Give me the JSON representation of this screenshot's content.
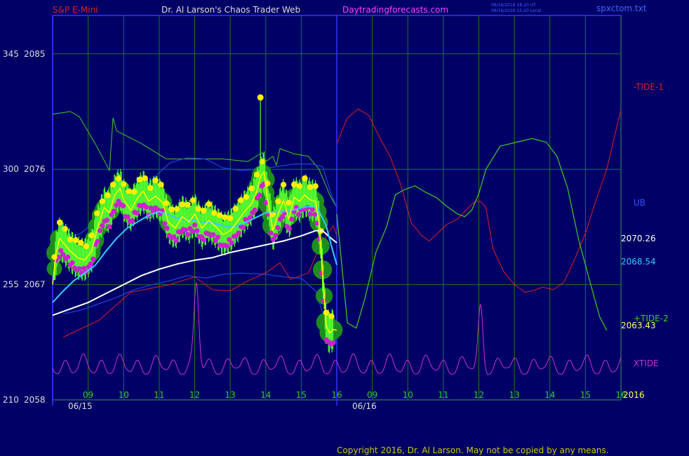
{
  "header": {
    "left": "S&P E-Mini",
    "center": "Dr. Al Larson's Chaos Trader Web",
    "site": "Daytradingforecasts.com",
    "stamp1": "06/16/2016 18:20 UT",
    "stamp2": "06/16/2016 15:20 Local",
    "file": "spxctom.txt"
  },
  "footer": {
    "copyright": "Copyright 2016, Dr. Al Larson. May not be copied by any means."
  },
  "colors": {
    "background": "#000066",
    "frame": "#3333ff",
    "grid": "#1a7a1a",
    "price": "#ffff00",
    "ma_fast": "#33ccff",
    "ma_slow": "#ffffff",
    "band": "#2244dd",
    "tide1": "#dd2222",
    "tide2": "#44cc22",
    "xtide": "#cc33cc",
    "text": "#dddddd",
    "header_red": "#dd2222",
    "header_site": "#ff44ff"
  },
  "chart_data": {
    "type": "line",
    "title": "S&P E-Mini",
    "ylim": [
      2058,
      2088
    ],
    "yticks_left": [
      {
        "a": "345",
        "b": "2085",
        "v": 2085
      },
      {
        "a": "300",
        "b": "2076",
        "v": 2076
      },
      {
        "a": "255",
        "b": "2067",
        "v": 2067
      },
      {
        "a": "210",
        "b": "2058",
        "v": 2058
      }
    ],
    "xticks": [
      {
        "label": "09",
        "x": 9.0
      },
      {
        "label": "10",
        "x": 10.0
      },
      {
        "label": "11",
        "x": 11.0
      },
      {
        "label": "12",
        "x": 12.0
      },
      {
        "label": "13",
        "x": 13.0
      },
      {
        "label": "14",
        "x": 14.0
      },
      {
        "label": "15",
        "x": 15.0
      },
      {
        "label": "16",
        "x": 16.0
      },
      {
        "label": "09",
        "x": 17.0
      },
      {
        "label": "10",
        "x": 18.0
      },
      {
        "label": "11",
        "x": 19.0
      },
      {
        "label": "12",
        "x": 20.0
      },
      {
        "label": "13",
        "x": 21.0
      },
      {
        "label": "14",
        "x": 22.0
      },
      {
        "label": "15",
        "x": 23.0
      },
      {
        "label": "16",
        "x": 24.0
      }
    ],
    "xlim": [
      8.0,
      24.0
    ],
    "days": [
      {
        "label": "06/15",
        "x": 8.0
      },
      {
        "label": "06/16",
        "x": 16.0
      }
    ],
    "right_labels": {
      "tide1": "-TIDE-1",
      "ub": "UB",
      "slow": "2070.26",
      "fast": "2068.54",
      "tide2": "+TIDE-2",
      "last": "2063.43",
      "xtide": "XTIDE",
      "year": "2016"
    },
    "series": {
      "price": [
        [
          8.0,
          2067.0
        ],
        [
          8.1,
          2069.5
        ],
        [
          8.2,
          2070.6
        ],
        [
          8.35,
          2070.1
        ],
        [
          8.5,
          2069.6
        ],
        [
          8.7,
          2069.1
        ],
        [
          8.9,
          2068.9
        ],
        [
          9.1,
          2069.6
        ],
        [
          9.25,
          2071.3
        ],
        [
          9.45,
          2073.0
        ],
        [
          9.6,
          2072.6
        ],
        [
          9.75,
          2074.0
        ],
        [
          9.9,
          2074.5
        ],
        [
          10.0,
          2073.6
        ],
        [
          10.2,
          2072.8
        ],
        [
          10.4,
          2073.8
        ],
        [
          10.55,
          2074.3
        ],
        [
          10.7,
          2073.5
        ],
        [
          10.9,
          2073.9
        ],
        [
          11.1,
          2073.4
        ],
        [
          11.25,
          2071.9
        ],
        [
          11.45,
          2071.4
        ],
        [
          11.65,
          2072.3
        ],
        [
          11.85,
          2071.9
        ],
        [
          12.0,
          2072.5
        ],
        [
          12.2,
          2071.4
        ],
        [
          12.4,
          2072.0
        ],
        [
          12.6,
          2071.5
        ],
        [
          12.8,
          2070.9
        ],
        [
          13.0,
          2071.2
        ],
        [
          13.2,
          2071.9
        ],
        [
          13.4,
          2072.7
        ],
        [
          13.6,
          2073.3
        ],
        [
          13.75,
          2074.3
        ],
        [
          13.85,
          2075.4
        ],
        [
          13.95,
          2075.8
        ],
        [
          14.05,
          2073.7
        ],
        [
          14.2,
          2071.2
        ],
        [
          14.35,
          2072.5
        ],
        [
          14.5,
          2073.6
        ],
        [
          14.65,
          2072.1
        ],
        [
          14.8,
          2073.8
        ],
        [
          14.95,
          2073.5
        ],
        [
          15.1,
          2074.0
        ],
        [
          15.25,
          2073.6
        ],
        [
          15.4,
          2073.5
        ],
        [
          15.5,
          2071.8
        ],
        [
          15.6,
          2068.0
        ],
        [
          15.7,
          2063.8
        ],
        [
          15.8,
          2063.2
        ],
        [
          15.9,
          2063.5
        ],
        [
          16.0,
          2063.43
        ]
      ],
      "ma_fast": [
        [
          8.0,
          2065.6
        ],
        [
          8.3,
          2066.5
        ],
        [
          8.6,
          2067.3
        ],
        [
          8.9,
          2067.9
        ],
        [
          9.2,
          2068.5
        ],
        [
          9.5,
          2069.6
        ],
        [
          9.8,
          2070.6
        ],
        [
          10.1,
          2071.4
        ],
        [
          10.4,
          2071.9
        ],
        [
          10.7,
          2072.4
        ],
        [
          11.0,
          2072.7
        ],
        [
          11.3,
          2072.4
        ],
        [
          11.6,
          2072.1
        ],
        [
          11.9,
          2072.0
        ],
        [
          12.2,
          2071.9
        ],
        [
          12.5,
          2071.8
        ],
        [
          12.8,
          2071.6
        ],
        [
          13.1,
          2071.5
        ],
        [
          13.4,
          2071.8
        ],
        [
          13.7,
          2072.2
        ],
        [
          14.0,
          2072.6
        ],
        [
          14.3,
          2072.7
        ],
        [
          14.6,
          2072.7
        ],
        [
          14.9,
          2072.9
        ],
        [
          15.2,
          2073.1
        ],
        [
          15.45,
          2073.0
        ],
        [
          15.7,
          2071.6
        ],
        [
          15.85,
          2070.0
        ],
        [
          16.0,
          2068.54
        ]
      ],
      "ma_slow": [
        [
          8.0,
          2064.6
        ],
        [
          8.5,
          2065.1
        ],
        [
          9.0,
          2065.6
        ],
        [
          9.5,
          2066.3
        ],
        [
          10.0,
          2067.0
        ],
        [
          10.5,
          2067.7
        ],
        [
          11.0,
          2068.2
        ],
        [
          11.5,
          2068.6
        ],
        [
          12.0,
          2068.9
        ],
        [
          12.5,
          2069.1
        ],
        [
          13.0,
          2069.5
        ],
        [
          13.5,
          2069.8
        ],
        [
          14.0,
          2070.1
        ],
        [
          14.5,
          2070.4
        ],
        [
          15.0,
          2070.8
        ],
        [
          15.4,
          2071.2
        ],
        [
          15.6,
          2071.2
        ],
        [
          15.8,
          2070.7
        ],
        [
          16.0,
          2070.26
        ]
      ],
      "band_upper": [
        [
          8.3,
          2070.5
        ],
        [
          8.8,
          2071.0
        ],
        [
          9.3,
          2072.2
        ],
        [
          9.8,
          2073.3
        ],
        [
          10.3,
          2074.2
        ],
        [
          10.8,
          2075.2
        ],
        [
          11.3,
          2076.5
        ],
        [
          11.8,
          2076.9
        ],
        [
          12.3,
          2076.8
        ],
        [
          12.8,
          2076.1
        ],
        [
          13.3,
          2075.9
        ],
        [
          13.8,
          2076.0
        ],
        [
          14.3,
          2076.2
        ],
        [
          14.8,
          2076.4
        ],
        [
          15.3,
          2076.4
        ],
        [
          15.6,
          2076.2
        ],
        [
          15.85,
          2074.0
        ],
        [
          16.0,
          2073.0
        ]
      ],
      "band_lower": [
        [
          8.3,
          2064.7
        ],
        [
          8.8,
          2065.0
        ],
        [
          9.3,
          2065.5
        ],
        [
          9.8,
          2066.0
        ],
        [
          10.3,
          2066.6
        ],
        [
          10.8,
          2067.0
        ],
        [
          11.3,
          2067.3
        ],
        [
          11.8,
          2067.7
        ],
        [
          12.3,
          2067.5
        ],
        [
          12.8,
          2067.8
        ],
        [
          13.3,
          2067.9
        ],
        [
          14.0,
          2067.8
        ],
        [
          14.5,
          2067.6
        ],
        [
          15.0,
          2067.5
        ],
        [
          15.4,
          2066.5
        ],
        [
          15.7,
          2064.0
        ],
        [
          16.0,
          2062.4
        ]
      ],
      "red_low": [
        [
          8.3,
          2062.9
        ],
        [
          9.3,
          2064.2
        ],
        [
          10.2,
          2066.4
        ],
        [
          11.3,
          2067.0
        ],
        [
          12.0,
          2067.6
        ],
        [
          12.5,
          2066.6
        ],
        [
          13.0,
          2066.5
        ],
        [
          13.5,
          2067.3
        ],
        [
          14.0,
          2067.9
        ],
        [
          14.4,
          2068.7
        ],
        [
          14.7,
          2067.4
        ],
        [
          15.2,
          2067.9
        ],
        [
          15.5,
          2069.8
        ],
        [
          15.8,
          2071.2
        ],
        [
          15.9,
          2071.6
        ],
        [
          16.0,
          2070.8
        ]
      ],
      "green_hi": [
        [
          8.0,
          2080.3
        ],
        [
          8.5,
          2080.5
        ],
        [
          8.75,
          2080.1
        ],
        [
          9.2,
          2078.0
        ],
        [
          9.6,
          2075.9
        ],
        [
          9.7,
          2080.0
        ],
        [
          9.8,
          2079.0
        ],
        [
          10.5,
          2078.0
        ],
        [
          11.2,
          2076.8
        ],
        [
          12.0,
          2076.8
        ],
        [
          12.8,
          2076.8
        ],
        [
          13.5,
          2076.6
        ],
        [
          13.9,
          2077.3
        ],
        [
          14.0,
          2076.6
        ],
        [
          14.2,
          2077.0
        ],
        [
          14.3,
          2076.3
        ],
        [
          14.4,
          2077.6
        ],
        [
          14.8,
          2077.2
        ],
        [
          15.2,
          2077.0
        ],
        [
          15.5,
          2076.0
        ],
        [
          15.8,
          2074.0
        ],
        [
          16.0,
          2073.0
        ]
      ],
      "tide1": [
        [
          16.0,
          2078.0
        ],
        [
          16.3,
          2080.0
        ],
        [
          16.6,
          2080.7
        ],
        [
          16.9,
          2080.2
        ],
        [
          17.2,
          2078.5
        ],
        [
          17.5,
          2077.0
        ],
        [
          17.8,
          2074.8
        ],
        [
          18.1,
          2071.8
        ],
        [
          18.4,
          2070.8
        ],
        [
          18.6,
          2070.4
        ],
        [
          18.8,
          2070.9
        ],
        [
          19.1,
          2071.7
        ],
        [
          19.4,
          2072.1
        ],
        [
          19.7,
          2073.0
        ],
        [
          19.9,
          2073.5
        ],
        [
          20.05,
          2073.5
        ],
        [
          20.2,
          2073.0
        ],
        [
          20.4,
          2069.8
        ],
        [
          20.7,
          2068.0
        ],
        [
          21.0,
          2067.0
        ],
        [
          21.3,
          2066.4
        ],
        [
          21.5,
          2066.5
        ],
        [
          21.8,
          2066.8
        ],
        [
          22.1,
          2066.6
        ],
        [
          22.4,
          2067.2
        ],
        [
          22.7,
          2069.0
        ],
        [
          23.0,
          2071.0
        ],
        [
          23.3,
          2073.6
        ],
        [
          23.6,
          2076.0
        ],
        [
          23.9,
          2079.5
        ],
        [
          24.0,
          2080.6
        ]
      ],
      "tide2": [
        [
          16.0,
          2072.5
        ],
        [
          16.3,
          2064.0
        ],
        [
          16.55,
          2063.6
        ],
        [
          16.8,
          2066.0
        ],
        [
          17.1,
          2069.5
        ],
        [
          17.4,
          2071.5
        ],
        [
          17.65,
          2074.0
        ],
        [
          17.9,
          2074.4
        ],
        [
          18.2,
          2074.7
        ],
        [
          18.5,
          2074.2
        ],
        [
          18.8,
          2073.8
        ],
        [
          19.1,
          2073.1
        ],
        [
          19.4,
          2072.5
        ],
        [
          19.6,
          2072.3
        ],
        [
          19.8,
          2072.8
        ],
        [
          20.0,
          2074.1
        ],
        [
          20.2,
          2076.0
        ],
        [
          20.6,
          2077.8
        ],
        [
          21.2,
          2078.2
        ],
        [
          21.5,
          2078.4
        ],
        [
          21.9,
          2078.1
        ],
        [
          22.2,
          2077.0
        ],
        [
          22.5,
          2074.5
        ],
        [
          22.8,
          2070.6
        ],
        [
          23.1,
          2067.5
        ],
        [
          23.4,
          2064.5
        ],
        [
          23.6,
          2063.43
        ]
      ]
    }
  }
}
